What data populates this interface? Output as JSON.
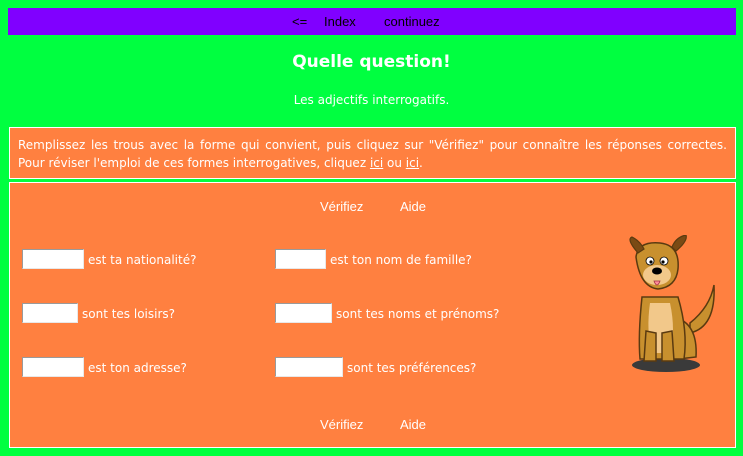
{
  "nav": {
    "back_label": "<=",
    "index_label": "Index",
    "continue_label": "continuez"
  },
  "header": {
    "title": "Quelle question!",
    "subtitle": "Les adjectifs interrogatifs."
  },
  "instructions": {
    "text_part1": "Remplissez les trous avec la forme qui convient, puis cliquez sur \"Vérifiez\" pour connaître les réponses correctes. Pour réviser l'emploi de ces formes interrogatives, cliquez ",
    "link1": "ici",
    "between": " ou ",
    "link2": "ici",
    "end": "."
  },
  "actions": {
    "check_label": "Vérifiez",
    "help_label": "Aide"
  },
  "questions": [
    {
      "value": "",
      "text": "est ta nationalité?"
    },
    {
      "value": "",
      "text": "est ton nom de famille?"
    },
    {
      "value": "",
      "text": "sont tes loisirs?"
    },
    {
      "value": "",
      "text": "sont tes noms et prénoms?"
    },
    {
      "value": "",
      "text": "est ton adresse?"
    },
    {
      "value": "",
      "text": "sont tes préférences?"
    }
  ],
  "colors": {
    "page_background": "#00ff40",
    "nav_background": "#8000ff",
    "panel_background": "#ff8040",
    "text": "#ffffff"
  },
  "illustration": "cartoon-dog"
}
